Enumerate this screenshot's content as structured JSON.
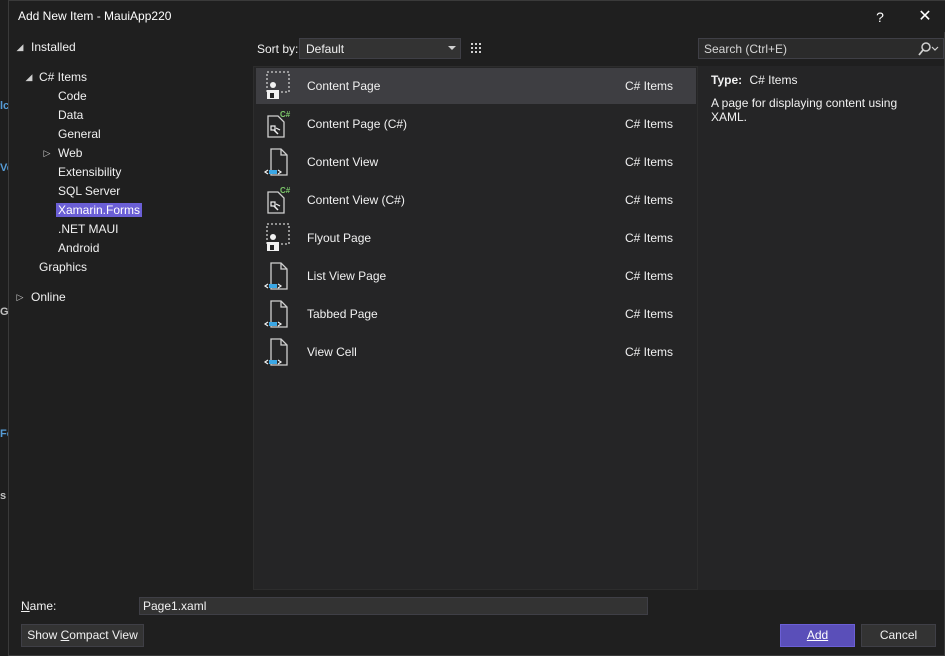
{
  "window": {
    "title": "Add New Item - MauiApp220",
    "help": "?",
    "close": "✕"
  },
  "tree": {
    "installed": "Installed",
    "csharp_items": "C# Items",
    "children": [
      "Code",
      "Data",
      "General",
      "Web",
      "Extensibility",
      "SQL Server",
      "Xamarin.Forms",
      ".NET MAUI",
      "Android"
    ],
    "graphics": "Graphics",
    "online": "Online"
  },
  "toolbar": {
    "sort_label": "Sort by:",
    "sort_value": "Default",
    "search_placeholder": "Search (Ctrl+E)"
  },
  "templates": [
    {
      "name": "Content Page",
      "category": "C# Items",
      "icon": "content-page-icon"
    },
    {
      "name": "Content Page (C#)",
      "category": "C# Items",
      "icon": "csharp-page-icon"
    },
    {
      "name": "Content View",
      "category": "C# Items",
      "icon": "xaml-view-icon"
    },
    {
      "name": "Content View (C#)",
      "category": "C# Items",
      "icon": "csharp-page-icon"
    },
    {
      "name": "Flyout Page",
      "category": "C# Items",
      "icon": "content-page-icon"
    },
    {
      "name": "List View Page",
      "category": "C# Items",
      "icon": "xaml-view-icon"
    },
    {
      "name": "Tabbed Page",
      "category": "C# Items",
      "icon": "xaml-view-icon"
    },
    {
      "name": "View Cell",
      "category": "C# Items",
      "icon": "xaml-view-icon"
    }
  ],
  "description": {
    "type_label": "Type:",
    "type_value": "C# Items",
    "text": "A page for displaying content using XAML."
  },
  "footer": {
    "name_label": "Name:",
    "name_value": "Page1.xaml",
    "compact_button": {
      "pre": "Show ",
      "accel": "C",
      "post": "ompact View"
    },
    "add_button": "Add",
    "cancel_button": "Cancel"
  },
  "colors": {
    "accent": "#6b5fd6",
    "background": "#1f1f1f",
    "panel": "#252526"
  }
}
